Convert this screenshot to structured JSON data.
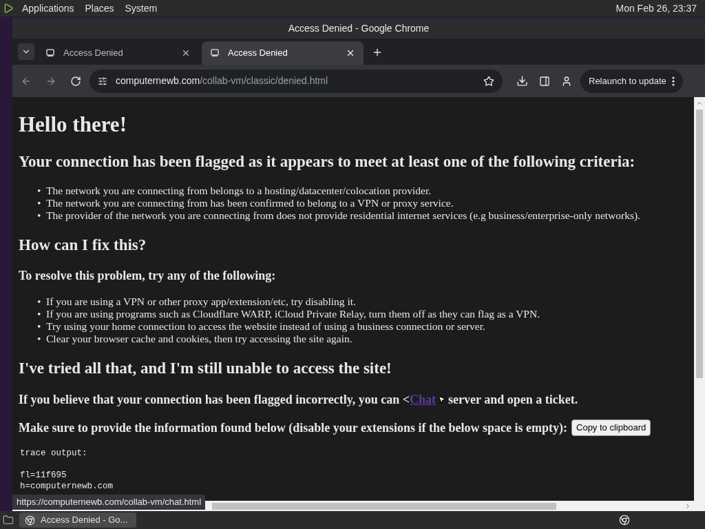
{
  "top_panel": {
    "menus": [
      "Applications",
      "Places",
      "System"
    ],
    "clock": "Mon Feb 26, 23:37"
  },
  "window": {
    "title": "Access Denied - Google Chrome"
  },
  "tabs": [
    {
      "label": "Access Denied",
      "selected": false
    },
    {
      "label": "Access Denied",
      "selected": true
    }
  ],
  "address_bar": {
    "domain": "computernewb.com",
    "path": "/collab-vm/classic/denied.html"
  },
  "relaunch_button": "Relaunch to update",
  "page": {
    "title": "Hello there!",
    "criteria_heading": "Your connection has been flagged as it appears to meet at least one of the following criteria:",
    "criteria": [
      {
        "marker": "•",
        "text": "The network you are connecting from belongs to a hosting/datacenter/colocation provider."
      },
      {
        "marker": "•",
        "text": "The network you are connecting from has been confirmed to belong to a VPN or proxy service."
      },
      {
        "marker": "•",
        "text": "The provider of the network you are connecting from does not provide residential internet services (e.g business/enterprise-only networks)."
      }
    ],
    "fix_heading": "How can I fix this?",
    "resolve_heading": "To resolve this problem, try any of the following:",
    "steps": [
      {
        "marker": "•",
        "text": "If you are using a VPN or other proxy app/extension/etc, try disabling it."
      },
      {
        "marker": "•",
        "text": "If you are using programs such as Cloudflare WARP, iCloud Private Relay, turn them off as they can flag as a VPN."
      },
      {
        "marker": "•",
        "text": "Try using your home connection to access the website instead of using a business connection or server."
      },
      {
        "marker": "•",
        "text": "Clear your browser cache and cookies, then try accessing the site again."
      }
    ],
    "tried_heading": "I've tried all that, and I'm still unable to access the site!",
    "contact_before": "If you believe that your connection has been flagged incorrectly, you can <",
    "contact_link": "Chat",
    "contact_after": " server and open a ticket.",
    "info_text": "Make sure to provide the information found below (disable your extensions if the below space is empty):",
    "copy_button": "Copy to clipboard",
    "trace": {
      "header": "trace output:",
      "lines": [
        "fl=11f695",
        "h=computernewb.com"
      ]
    }
  },
  "status_url": "https://computernewb.com/collab-vm/chat.html",
  "taskbar": [
    {
      "label": "Access Denied - Go...",
      "selected": true
    }
  ]
}
